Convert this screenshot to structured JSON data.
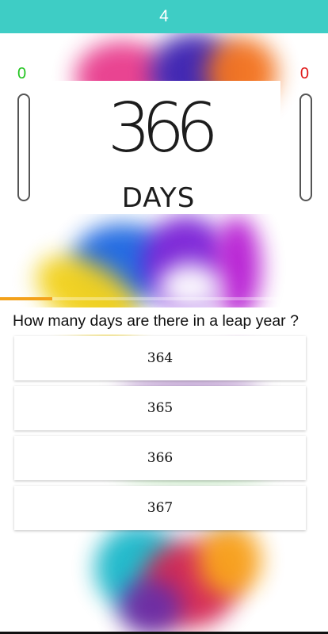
{
  "header": {
    "question_number": "4"
  },
  "scores": {
    "left": "0",
    "right": "0"
  },
  "image": {
    "number_text": "366",
    "days_text": "DAYS"
  },
  "progress": {
    "fraction": 0.16,
    "color": "#f3a11a"
  },
  "question": {
    "text": "How many days are there in a leap year ?"
  },
  "answers": [
    {
      "label": "364"
    },
    {
      "label": "365"
    },
    {
      "label": "366"
    },
    {
      "label": "367"
    }
  ],
  "colors": {
    "header_bg": "#3ecdc5",
    "score_left": "#22c41f",
    "score_right": "#e01818"
  }
}
